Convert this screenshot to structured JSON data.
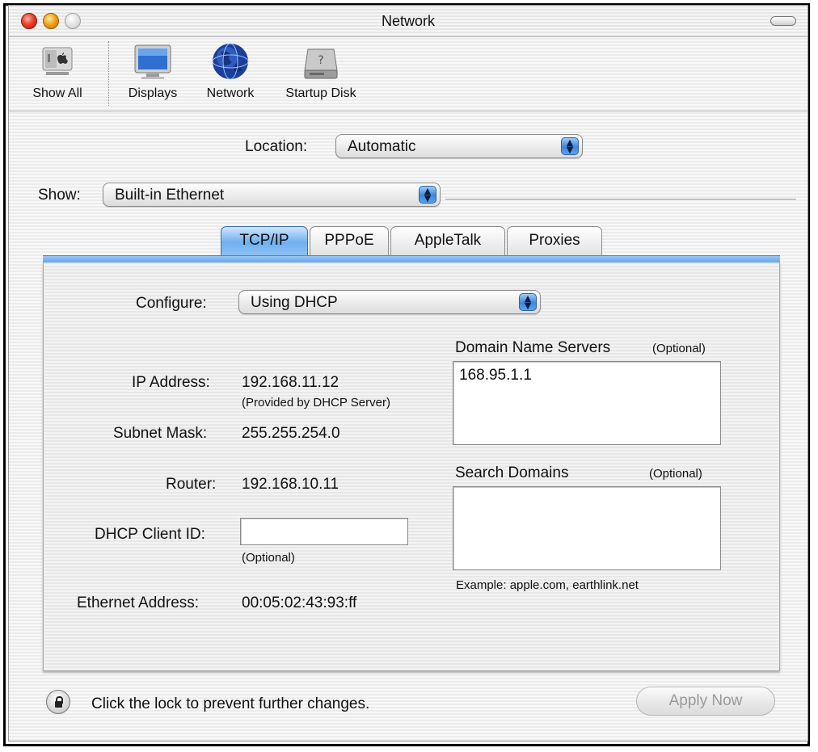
{
  "window": {
    "title": "Network"
  },
  "toolbar": {
    "items": [
      {
        "label": "Show All",
        "icon": "apple-logo-icon"
      },
      {
        "label": "Displays",
        "icon": "display-icon"
      },
      {
        "label": "Network",
        "icon": "globe-icon"
      },
      {
        "label": "Startup Disk",
        "icon": "hard-disk-icon"
      }
    ]
  },
  "location": {
    "label": "Location:",
    "value": "Automatic"
  },
  "show": {
    "label": "Show:",
    "value": "Built-in Ethernet"
  },
  "tabs": [
    {
      "label": "TCP/IP",
      "active": true
    },
    {
      "label": "PPPoE",
      "active": false
    },
    {
      "label": "AppleTalk",
      "active": false
    },
    {
      "label": "Proxies",
      "active": false
    }
  ],
  "tcpip": {
    "configure": {
      "label": "Configure:",
      "value": "Using DHCP"
    },
    "ip_address": {
      "label": "IP Address:",
      "value": "192.168.11.12",
      "note": "(Provided by DHCP Server)"
    },
    "subnet_mask": {
      "label": "Subnet Mask:",
      "value": "255.255.254.0"
    },
    "router": {
      "label": "Router:",
      "value": "192.168.10.11"
    },
    "dhcp_client_id": {
      "label": "DHCP Client ID:",
      "value": "",
      "note": "(Optional)"
    },
    "ethernet_address": {
      "label": "Ethernet Address:",
      "value": "00:05:02:43:93:ff"
    },
    "dns": {
      "label": "Domain Name Servers",
      "optional": "(Optional)",
      "value": "168.95.1.1"
    },
    "search_domains": {
      "label": "Search Domains",
      "optional": "(Optional)",
      "value": "",
      "example": "Example: apple.com, earthlink.net"
    }
  },
  "footer": {
    "lock_text": "Click the lock to prevent further changes.",
    "apply_label": "Apply Now"
  },
  "colors": {
    "accent": "#5fa3ea",
    "tab_active": "#6fb0ef",
    "close": "#e8412c",
    "minimize": "#f3a41b"
  }
}
